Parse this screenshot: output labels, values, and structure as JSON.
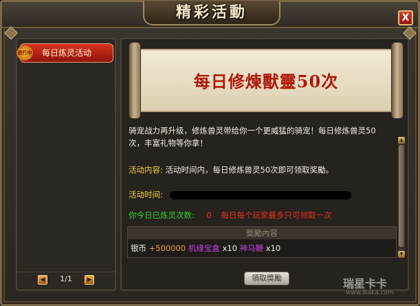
{
  "window": {
    "title": "精彩活動",
    "close_label": "X"
  },
  "sidebar": {
    "items": [
      {
        "label": "每日炼灵活动",
        "badge": "进行中"
      }
    ],
    "pager": {
      "prev": "◀",
      "page_text": "1/1",
      "next": "▶"
    }
  },
  "banner": {
    "title": "每日修煉獸靈50次"
  },
  "activity": {
    "description": "骑宠战力再升级，修炼兽灵带给你一个更威猛的骑宠！每日修炼兽灵50次，丰富礼物等你拿！",
    "content_label": "活动内容:",
    "content_value": "活动时间内，每日修炼兽灵50次即可领取奖勵。",
    "time_label": "活动时间:",
    "count_label": "你今日已炼灵次数:",
    "count_value": "0",
    "count_note": "每日每个玩家最多只可领取一次"
  },
  "reward": {
    "header": "獎勵內容",
    "items": [
      {
        "text": "银币",
        "color": "#f0ece4"
      },
      {
        "text": " +500000 ",
        "color": "#f0a030"
      },
      {
        "text": "机缘宝盒",
        "color": "#c040e0"
      },
      {
        "text": " x10 ",
        "color": "#f0ece4"
      },
      {
        "text": "神马鞭",
        "color": "#c040e0"
      },
      {
        "text": " x10",
        "color": "#f0ece4"
      }
    ]
  },
  "claim_button": {
    "label": "領取獎勵"
  },
  "watermark": {
    "text": "瑞星卡卡",
    "url": "www.ikaka.com"
  }
}
